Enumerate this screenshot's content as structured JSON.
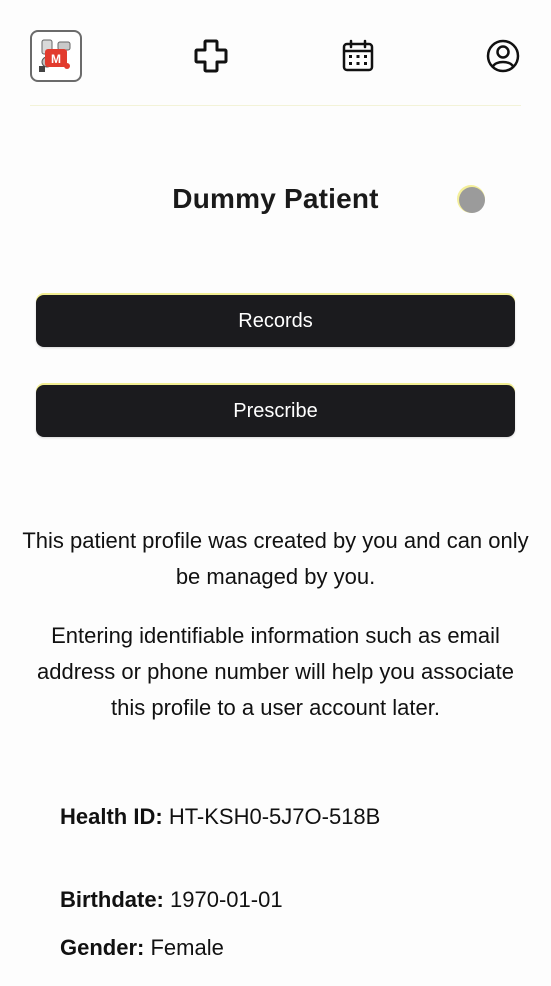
{
  "nav": {
    "logo_icon": "app-logo-icon",
    "add_icon": "plus-icon",
    "calendar_icon": "calendar-icon",
    "profile_icon": "user-circle-icon"
  },
  "patient": {
    "name": "Dummy Patient",
    "status_color": "#9b9b9b"
  },
  "actions": {
    "records_label": "Records",
    "prescribe_label": "Prescribe"
  },
  "notice": {
    "line1": "This patient profile was created by you and can only be managed by you.",
    "line2": "Entering identifiable information such as email address or phone number will help you associate this profile to a user account later."
  },
  "details": {
    "health_id_label": "Health ID:",
    "health_id_value": "HT-KSH0-5J7O-518B",
    "birthdate_label": "Birthdate:",
    "birthdate_value": "1970-01-01",
    "gender_label": "Gender:",
    "gender_value": "Female"
  },
  "colors": {
    "button_bg": "#1b1b1e",
    "accent_yellow": "#f2ee92"
  }
}
